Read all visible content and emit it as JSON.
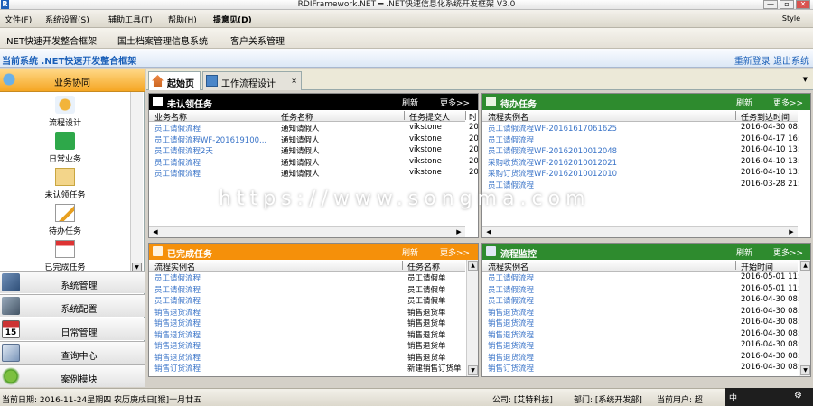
{
  "window": {
    "title": "RDIFramework.NET ━ .NET快速信息化系统开发框架 V3.0",
    "logo": "R"
  },
  "menu": {
    "items": [
      "文件(F)",
      "系统设置(S)",
      "辅助工具(T)",
      "帮助(H)",
      "提意见(D)"
    ],
    "style_label": "Style"
  },
  "systems": {
    "items": [
      ".NET快速开发整合框架",
      "国土档案管理信息系统",
      "客户关系管理"
    ]
  },
  "info": {
    "current_system": "当前系统 .NET快速开发整合框架",
    "relogin": "重新登录",
    "logout": "退出系统"
  },
  "sidebar": {
    "header": "业务协同",
    "items": [
      "流程设计",
      "日常业务",
      "未认领任务",
      "待办任务",
      "已完成任务"
    ],
    "nav": [
      "系统管理",
      "系统配置",
      "日常管理",
      "查询中心",
      "案例模块"
    ]
  },
  "tabs": [
    {
      "label": "起始页"
    },
    {
      "label": "工作流程设计"
    }
  ],
  "panels": {
    "unclaimed": {
      "title": "未认领任务",
      "refresh": "刷新",
      "more": "更多>>",
      "columns": [
        "业务名称",
        "任务名称",
        "任务提交人",
        "时"
      ],
      "rows": [
        [
          "员工请假流程",
          "通知请假人",
          "vikstone",
          "20"
        ],
        [
          "员工请假流程WF-201619100...",
          "通知请假人",
          "vikstone",
          "20"
        ],
        [
          "员工请假流程2天",
          "通知请假人",
          "vikstone",
          "20"
        ],
        [
          "员工请假流程",
          "通知请假人",
          "vikstone",
          "20"
        ],
        [
          "员工请假流程",
          "通知请假人",
          "vikstone",
          "20"
        ]
      ]
    },
    "todo": {
      "title": "待办任务",
      "refresh": "刷新",
      "more": "更多>>",
      "columns": [
        "流程实例名",
        "任务到达时间"
      ],
      "rows": [
        [
          "员工请假流程WF-20161617061625",
          "2016-04-30 08:3"
        ],
        [
          "员工请假流程",
          "2016-04-17 16:5"
        ],
        [
          "员工请假流程WF-20162010012048",
          "2016-04-10 13:2"
        ],
        [
          "采购收货流程WF-20162010012021",
          "2016-04-10 13:2"
        ],
        [
          "采购订货流程WF-20162010012010",
          "2016-04-10 13:2"
        ],
        [
          "员工请假流程",
          "2016-03-28 21:4"
        ]
      ]
    },
    "completed": {
      "title": "已完成任务",
      "refresh": "刷新",
      "more": "更多>>",
      "columns": [
        "流程实例名",
        "任务名称"
      ],
      "rows": [
        [
          "员工请假流程",
          "员工请假单"
        ],
        [
          "员工请假流程",
          "员工请假单"
        ],
        [
          "员工请假流程",
          "员工请假单"
        ],
        [
          "销售退货流程",
          "销售退货单"
        ],
        [
          "销售退货流程",
          "销售退货单"
        ],
        [
          "销售退货流程",
          "销售退货单"
        ],
        [
          "销售退货流程",
          "销售退货单"
        ],
        [
          "销售退货流程",
          "销售退货单"
        ],
        [
          "销售订货流程",
          "新建销售订货单"
        ]
      ]
    },
    "monitor": {
      "title": "流程监控",
      "refresh": "刷新",
      "more": "更多>>",
      "columns": [
        "流程实例名",
        "开始时间"
      ],
      "rows": [
        [
          "员工请假流程",
          "2016-05-01 11:"
        ],
        [
          "员工请假流程",
          "2016-05-01 11:"
        ],
        [
          "员工请假流程",
          "2016-04-30 08:"
        ],
        [
          "销售退货流程",
          "2016-04-30 08:"
        ],
        [
          "销售退货流程",
          "2016-04-30 08:"
        ],
        [
          "销售退货流程",
          "2016-04-30 08:"
        ],
        [
          "销售退货流程",
          "2016-04-30 08:"
        ],
        [
          "销售退货流程",
          "2016-04-30 08:"
        ],
        [
          "销售订货流程",
          "2016-04-30 08:"
        ]
      ]
    }
  },
  "watermark": "https://www.songma.com",
  "status": {
    "date": "当前日期: 2016-11-24星期四 农历庚戌日[猴]十月廿五",
    "company": "公司: [艾特科技]",
    "dept": "部门: [系统开发部]",
    "user": "当前用户: 超"
  },
  "tray": {
    "text": "中"
  },
  "colors": {
    "black_head": "#000000",
    "green_head": "#2e8b2e",
    "orange_head": "#f5900a",
    "link": "#3a74c8"
  }
}
